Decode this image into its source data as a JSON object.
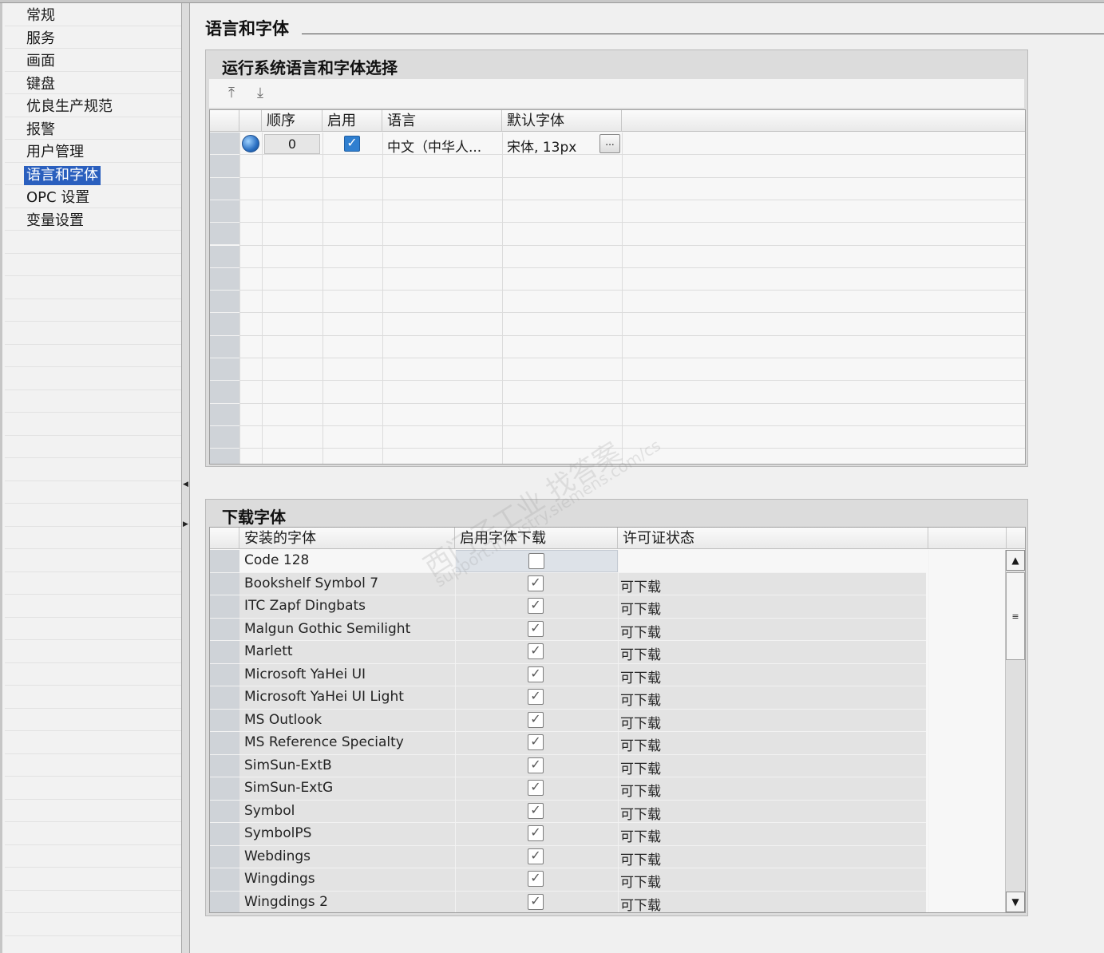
{
  "nav": {
    "items": [
      {
        "label": "常规"
      },
      {
        "label": "服务"
      },
      {
        "label": "画面"
      },
      {
        "label": "键盘"
      },
      {
        "label": "优良生产规范"
      },
      {
        "label": "报警"
      },
      {
        "label": "用户管理"
      },
      {
        "label": "语言和字体",
        "active": true
      },
      {
        "label": "OPC 设置"
      },
      {
        "label": "变量设置"
      }
    ]
  },
  "page": {
    "title": "语言和字体"
  },
  "runtime_section": {
    "title": "运行系统语言和字体选择",
    "toolbar": {
      "move_up_icon": "move-up-icon",
      "move_down_icon": "move-down-icon"
    },
    "columns": [
      "顺序",
      "启用",
      "语言",
      "默认字体"
    ],
    "rows": [
      {
        "order": "0",
        "enabled": true,
        "language": "中文（中华人...",
        "font": "宋体, 13px",
        "browse_label": "..."
      }
    ]
  },
  "download_section": {
    "title": "下载字体",
    "columns": [
      "安装的字体",
      "启用字体下载",
      "许可证状态"
    ],
    "fonts": [
      {
        "name": "Code 128",
        "enabled": false,
        "status": ""
      },
      {
        "name": "Bookshelf Symbol 7",
        "enabled": true,
        "status": "可下载"
      },
      {
        "name": "ITC Zapf Dingbats",
        "enabled": true,
        "status": "可下载"
      },
      {
        "name": "Malgun Gothic Semilight",
        "enabled": true,
        "status": "可下载"
      },
      {
        "name": "Marlett",
        "enabled": true,
        "status": "可下载"
      },
      {
        "name": "Microsoft YaHei UI",
        "enabled": true,
        "status": "可下载"
      },
      {
        "name": "Microsoft YaHei UI Light",
        "enabled": true,
        "status": "可下载"
      },
      {
        "name": "MS Outlook",
        "enabled": true,
        "status": "可下载"
      },
      {
        "name": "MS Reference Specialty",
        "enabled": true,
        "status": "可下载"
      },
      {
        "name": "SimSun-ExtB",
        "enabled": true,
        "status": "可下载"
      },
      {
        "name": "SimSun-ExtG",
        "enabled": true,
        "status": "可下载"
      },
      {
        "name": "Symbol",
        "enabled": true,
        "status": "可下载"
      },
      {
        "name": "SymbolPS",
        "enabled": true,
        "status": "可下载"
      },
      {
        "name": "Webdings",
        "enabled": true,
        "status": "可下载"
      },
      {
        "name": "Wingdings",
        "enabled": true,
        "status": "可下载"
      },
      {
        "name": "Wingdings 2",
        "enabled": true,
        "status": "可下载"
      }
    ]
  },
  "watermark": {
    "line1": "西门子工业  找答案",
    "line2": "support.industry.siemens.com/cs"
  }
}
